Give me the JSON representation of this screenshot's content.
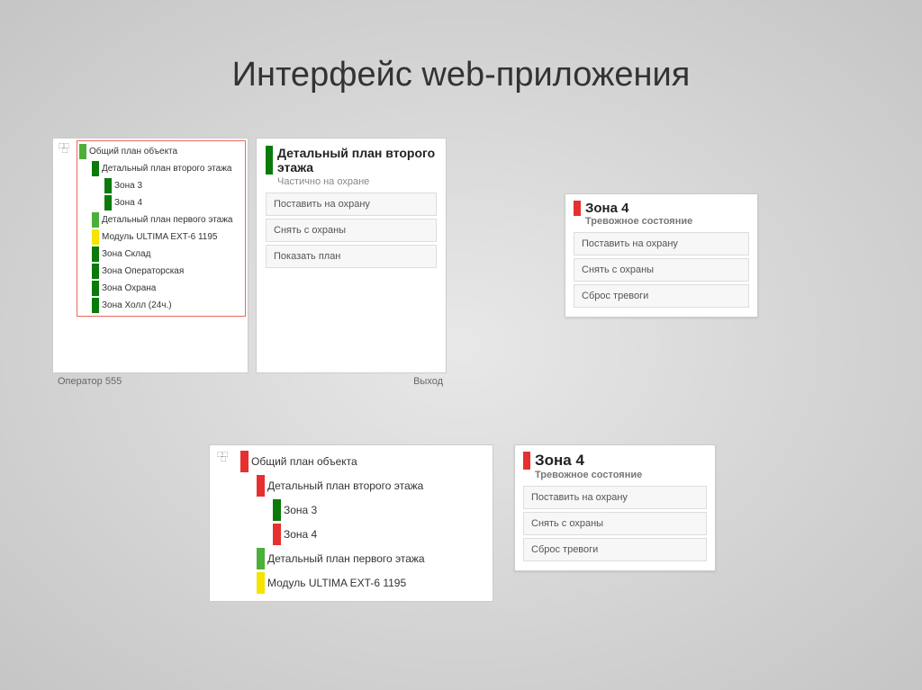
{
  "title": "Интерфейс web-приложения",
  "colors": {
    "green": "#4caf3a",
    "darkgreen": "#0a7a0a",
    "yellow": "#f4e400",
    "red": "#e63030"
  },
  "panel1": {
    "tree": [
      {
        "label": "Общий план объекта",
        "color": "green",
        "depth": 0
      },
      {
        "label": "Детальный план второго этажа",
        "color": "darkgreen",
        "depth": 1
      },
      {
        "label": "Зона 3",
        "color": "darkgreen",
        "depth": 2
      },
      {
        "label": "Зона 4",
        "color": "darkgreen",
        "depth": 2
      },
      {
        "label": "Детальный план первого этажа",
        "color": "green",
        "depth": 1
      },
      {
        "label": "Модуль ULTIMA EXT-6 1195",
        "color": "yellow",
        "depth": 1
      },
      {
        "label": "Зона Склад",
        "color": "darkgreen",
        "depth": 1
      },
      {
        "label": "Зона Операторская",
        "color": "darkgreen",
        "depth": 1
      },
      {
        "label": "Зона Охрана",
        "color": "darkgreen",
        "depth": 1
      },
      {
        "label": "Зона Холл (24ч.)",
        "color": "darkgreen",
        "depth": 1
      }
    ],
    "footer_left": "Оператор 555",
    "footer_right": "Выход"
  },
  "panel2": {
    "title": "Детальный план второго этажа",
    "subtitle": "Частично на охране",
    "actions": [
      "Поставить на охрану",
      "Снять с охраны",
      "Показать план"
    ]
  },
  "panel3": {
    "title": "Зона 4",
    "subtitle": "Тревожное состояние",
    "actions": [
      "Поставить на охрану",
      "Снять с охраны",
      "Сброс тревоги"
    ]
  },
  "panel4": {
    "tree": [
      {
        "label": "Общий план объекта",
        "color": "red",
        "depth": 0
      },
      {
        "label": "Детальный план второго этажа",
        "color": "red",
        "depth": 1
      },
      {
        "label": "Зона 3",
        "color": "darkgreen",
        "depth": 2
      },
      {
        "label": "Зона 4",
        "color": "red",
        "depth": 2
      },
      {
        "label": "Детальный план первого этажа",
        "color": "green",
        "depth": 1
      },
      {
        "label": "Модуль ULTIMA EXT-6 1195",
        "color": "yellow",
        "depth": 1
      }
    ]
  },
  "panel5": {
    "title": "Зона 4",
    "subtitle": "Тревожное состояние",
    "actions": [
      "Поставить на охрану",
      "Снять с охраны",
      "Сброс тревоги"
    ]
  }
}
